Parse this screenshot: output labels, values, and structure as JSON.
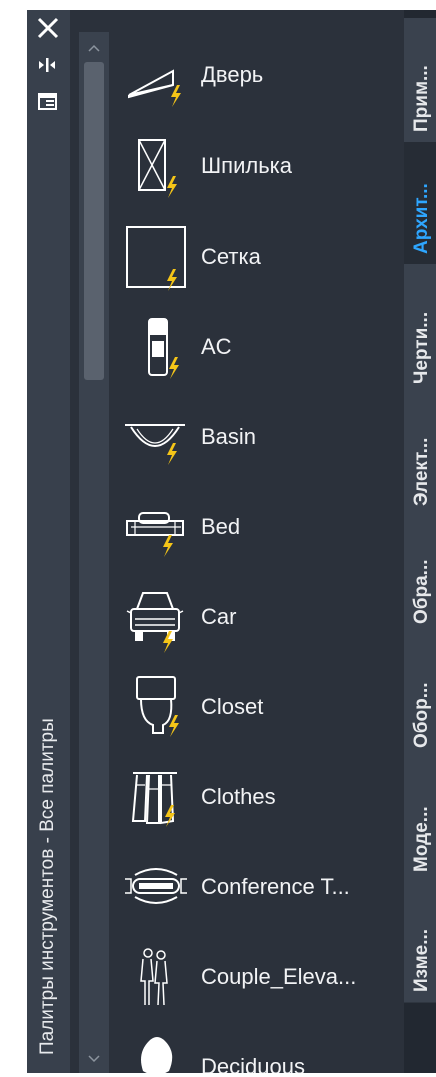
{
  "palette": {
    "title": "Палитры инструментов - Все палитры",
    "strip_icons": [
      "close-icon",
      "auto-hide-icon",
      "properties-icon"
    ]
  },
  "tools": [
    {
      "label": "Дверь",
      "icon": "door-icon"
    },
    {
      "label": "Шпилька",
      "icon": "pin-icon"
    },
    {
      "label": "Сетка",
      "icon": "grid-icon"
    },
    {
      "label": "AC",
      "icon": "ac-icon"
    },
    {
      "label": "Basin",
      "icon": "basin-icon"
    },
    {
      "label": "Bed",
      "icon": "bed-icon"
    },
    {
      "label": "Car",
      "icon": "car-icon"
    },
    {
      "label": "Closet",
      "icon": "closet-icon"
    },
    {
      "label": "Clothes",
      "icon": "clothes-icon"
    },
    {
      "label": "Conference T...",
      "icon": "conference-table-icon"
    },
    {
      "label": "Couple_Eleva...",
      "icon": "couple-elevation-icon"
    },
    {
      "label": "Deciduous",
      "icon": "deciduous-tree-icon"
    }
  ],
  "tabs": [
    {
      "label": "Прим...",
      "active": false
    },
    {
      "label": "Архит...",
      "active": true
    },
    {
      "label": "Черти...",
      "active": false
    },
    {
      "label": "Элект...",
      "active": false
    },
    {
      "label": "Обра...",
      "active": false
    },
    {
      "label": "Обор...",
      "active": false
    },
    {
      "label": "Моде...",
      "active": false
    },
    {
      "label": "Изме...",
      "active": false
    }
  ],
  "colors": {
    "background": "#2b313b",
    "tab_active_text": "#2ea6ff",
    "bolt": "#f5c518",
    "text": "#f2f3f5"
  }
}
